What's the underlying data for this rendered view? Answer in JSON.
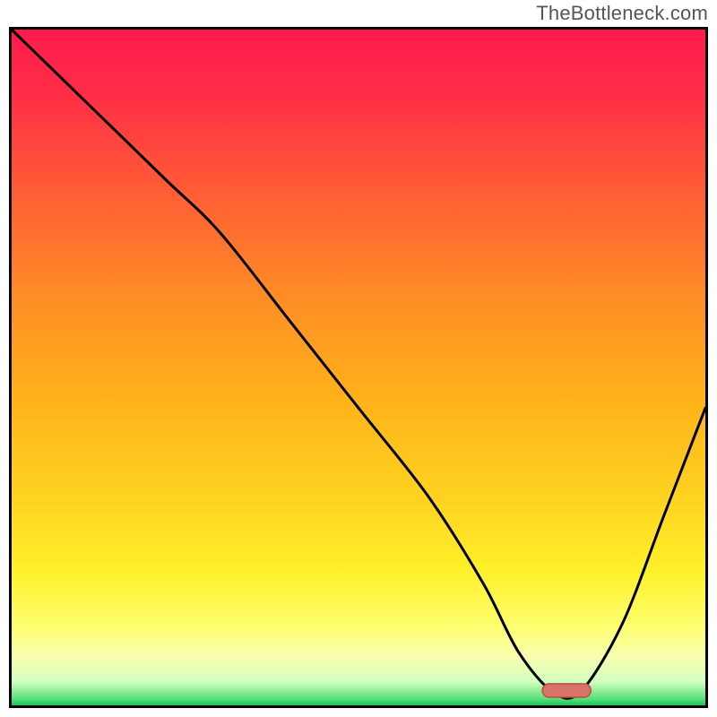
{
  "watermark": "TheBottleneck.com",
  "chart_data": {
    "type": "line",
    "title": "",
    "xlabel": "",
    "ylabel": "",
    "xlim": [
      0,
      100
    ],
    "ylim": [
      0,
      100
    ],
    "background_gradient": {
      "stops": [
        {
          "offset": 0.0,
          "color": "#ff1a4c"
        },
        {
          "offset": 0.1,
          "color": "#ff2f46"
        },
        {
          "offset": 0.25,
          "color": "#ff6034"
        },
        {
          "offset": 0.4,
          "color": "#ff8e25"
        },
        {
          "offset": 0.55,
          "color": "#ffb31a"
        },
        {
          "offset": 0.7,
          "color": "#ffd421"
        },
        {
          "offset": 0.8,
          "color": "#fff02a"
        },
        {
          "offset": 0.88,
          "color": "#ffff6c"
        },
        {
          "offset": 0.93,
          "color": "#f6ffb0"
        },
        {
          "offset": 0.965,
          "color": "#d2ffbf"
        },
        {
          "offset": 0.99,
          "color": "#5ce07a"
        },
        {
          "offset": 1.0,
          "color": "#12c85a"
        }
      ]
    },
    "series": [
      {
        "name": "bottleneck-curve",
        "color": "#000000",
        "x": [
          0,
          10,
          22,
          30,
          40,
          50,
          60,
          68,
          73,
          78,
          82,
          88,
          94,
          100
        ],
        "y": [
          100,
          90,
          78,
          70,
          57,
          44,
          31,
          18,
          8,
          2,
          2,
          12,
          28,
          44
        ]
      }
    ],
    "marker": {
      "name": "optimal-range",
      "x_center": 80,
      "x_width": 7,
      "y": 2.2,
      "height": 2.0,
      "fill": "#d9736a",
      "stroke": "#b85048"
    }
  }
}
